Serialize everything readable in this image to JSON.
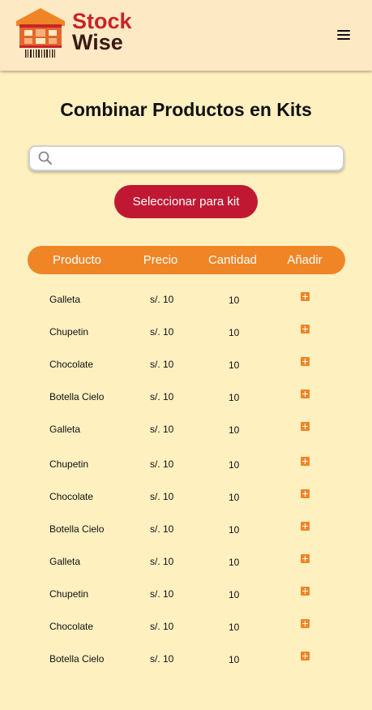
{
  "header": {
    "brand_line1": "Stock",
    "brand_line2": "Wise",
    "logo_icon": "warehouse-logo-icon",
    "menu_icon": "hamburger-menu-icon"
  },
  "page": {
    "title": "Combinar Productos en Kits"
  },
  "search": {
    "placeholder": "",
    "value": "",
    "icon": "search-icon"
  },
  "actions": {
    "select_for_kit_label": "Seleccionar para kit"
  },
  "table": {
    "columns": [
      "Producto",
      "Precio",
      "Cantidad",
      "Añadir"
    ],
    "rows": [
      {
        "product": "Galleta",
        "price": "s/. 10",
        "quantity": "10"
      },
      {
        "product": "Chupetin",
        "price": "s/. 10",
        "quantity": "10"
      },
      {
        "product": "Chocolate",
        "price": "s/. 10",
        "quantity": "10"
      },
      {
        "product": "Botella Cielo",
        "price": "s/. 10",
        "quantity": "10"
      },
      {
        "product": "Galleta",
        "price": "s/. 10",
        "quantity": "10"
      },
      {
        "product": "Chupetin",
        "price": "s/. 10",
        "quantity": "10"
      },
      {
        "product": "Chocolate",
        "price": "s/. 10",
        "quantity": "10"
      },
      {
        "product": "Botella Cielo",
        "price": "s/. 10",
        "quantity": "10"
      },
      {
        "product": "Galleta",
        "price": "s/. 10",
        "quantity": "10"
      },
      {
        "product": "Chupetin",
        "price": "s/. 10",
        "quantity": "10"
      },
      {
        "product": "Chocolate",
        "price": "s/. 10",
        "quantity": "10"
      },
      {
        "product": "Botella Cielo",
        "price": "s/. 10",
        "quantity": "10"
      }
    ],
    "add_icon": "plus-box-icon"
  },
  "colors": {
    "brand_red": "#c8232c",
    "brand_dark": "#3a1a14",
    "accent_orange": "#f08526",
    "button_red": "#c01832",
    "header_bg": "#fde9c4",
    "page_bg": "#fff0c0"
  }
}
